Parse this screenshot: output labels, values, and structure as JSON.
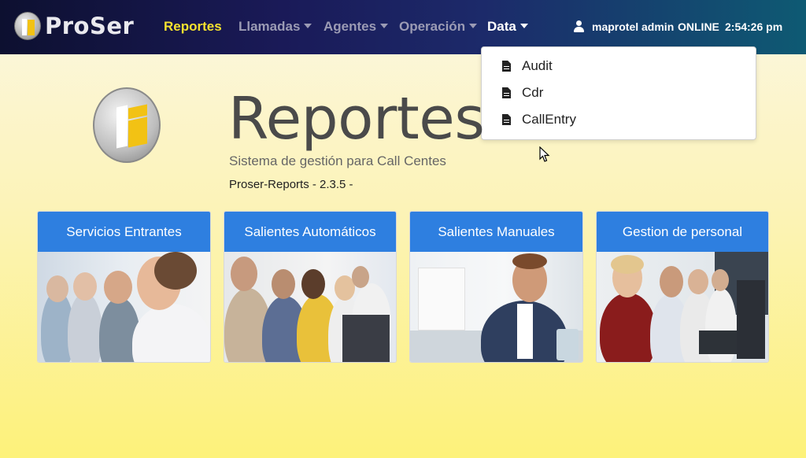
{
  "brand": {
    "name": "ProSer"
  },
  "nav": {
    "items": [
      {
        "label": "Reportes",
        "state": "active"
      },
      {
        "label": "Llamadas",
        "dropdown": true
      },
      {
        "label": "Agentes",
        "dropdown": true
      },
      {
        "label": "Operación",
        "dropdown": true
      },
      {
        "label": "Data",
        "dropdown": true,
        "state": "open"
      }
    ],
    "user": "maprotel admin",
    "status": "ONLINE",
    "time": "2:54:26 pm"
  },
  "data_menu": {
    "items": [
      {
        "label": "Audit",
        "icon": "file-icon"
      },
      {
        "label": "Cdr",
        "icon": "file-icon"
      },
      {
        "label": "CallEntry",
        "icon": "file-icon"
      }
    ]
  },
  "hero": {
    "title": "Reportes",
    "subtitle": "Sistema de gestión para Call Centes",
    "version": "Proser-Reports - 2.3.5 -"
  },
  "cards": [
    {
      "title": "Servicios Entrantes"
    },
    {
      "title": "Salientes Automáticos"
    },
    {
      "title": "Salientes Manuales"
    },
    {
      "title": "Gestion de personal"
    }
  ],
  "colors": {
    "accent": "#2e7fe0",
    "active_nav": "#f5e12f",
    "logo_yellow": "#f2c214"
  }
}
